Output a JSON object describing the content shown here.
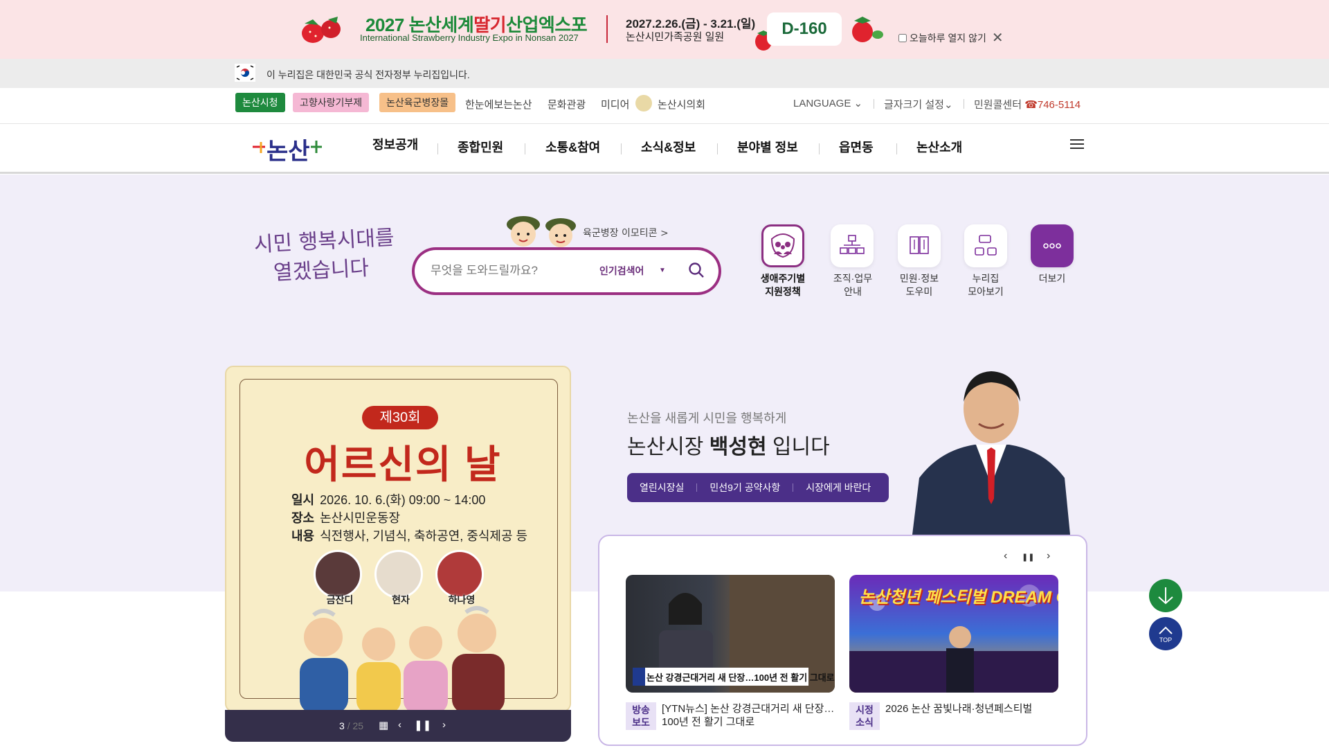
{
  "promo": {
    "title_prefix": "2027 논산세계",
    "title_highlight": "딸기",
    "title_suffix": "산업엑스포",
    "subtitle": "International Strawberry Industry Expo in Nonsan 2027",
    "dates": "2027.2.26.(금) - 3.21.(일)",
    "place": "논산시민가족공원 일원",
    "dday": "D-160",
    "hide_today_label": "오늘하루 열지 않기",
    "close_icon": "close-icon"
  },
  "gov": {
    "text": "이 누리집은 대한민국 공식 전자정부 누리집입니다."
  },
  "util": {
    "chips": [
      "논산시청",
      "고향사랑기부제",
      "논산육군병장몰"
    ],
    "links": [
      "한눈에보는논산",
      "문화관광",
      "미디어",
      "논산시의회"
    ],
    "language": "LANGUAGE",
    "font_size": "글자크기 설정",
    "callcenter_label": "민원콜센터",
    "callcenter_number": "746-5114"
  },
  "nav": {
    "logo_text": "논산",
    "items": [
      "정보공개",
      "종합민원",
      "소통&참여",
      "소식&정보",
      "분야별 정보",
      "읍면동",
      "논산소개"
    ]
  },
  "hero": {
    "slogan_line1": "시민 행복시대를",
    "slogan_line2": "열겠습니다",
    "search_placeholder": "무엇을 도와드릴까요?",
    "popular_label": "인기검색어",
    "mascot_link": "육군병장 이모티콘 >",
    "quick": [
      {
        "label1": "생애주기별",
        "label2": "지원정책"
      },
      {
        "label1": "조직·업무",
        "label2": "안내"
      },
      {
        "label1": "민원·정보",
        "label2": "도우미"
      },
      {
        "label1": "누리집",
        "label2": "모아보기"
      },
      {
        "label1": "더보기",
        "label2": ""
      }
    ]
  },
  "poster": {
    "badge": "제30회",
    "title": "어르신의 날",
    "line1_label": "일시",
    "line1_value": "2026. 10. 6.(화) 09:00 ~ 14:00",
    "line2_label": "장소",
    "line2_value": "논산시민운동장",
    "line3_label": "내용",
    "line3_value": "식전행사, 기념식, 축하공연, 중식제공 등",
    "performers": [
      "금잔디",
      "현자",
      "하나영"
    ],
    "page_current": "3",
    "page_total": "/ 25"
  },
  "mayor": {
    "subtitle": "논산을 새롭게 시민을 행복하게",
    "title_prefix": "논산시장",
    "name": "백성현",
    "title_suffix": "입니다",
    "buttons": [
      "열린시장실",
      "민선9기 공약사항",
      "시장에게 바란다"
    ]
  },
  "news": {
    "items": [
      {
        "tag1": "방송",
        "tag2": "보도",
        "line1": "[YTN뉴스] 논산 강경근대거리 새 단장…",
        "line2": "100년 전 활기 그대로",
        "caption": "논산 강경근대거리 새 단장…100년 전 활기 그대로"
      },
      {
        "tag1": "시정",
        "tag2": "소식",
        "line1": "2026 논산 꿈빛나래·청년페스티벌",
        "line2": "",
        "caption": "논산청년 페스티벌 DREAM CONCERT"
      }
    ]
  },
  "fab": {
    "top_label": "TOP"
  }
}
